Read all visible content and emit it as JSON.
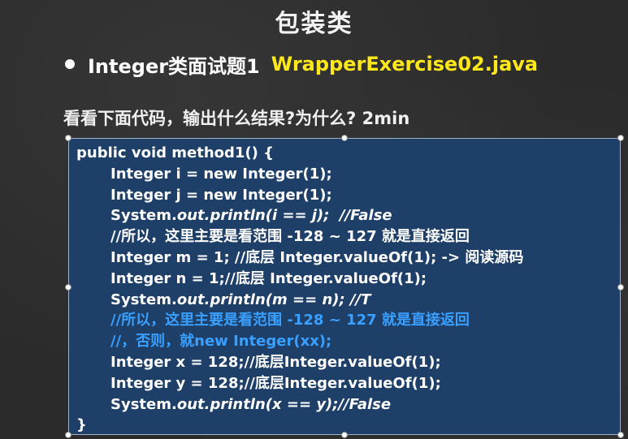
{
  "slide": {
    "title": "包装类",
    "bullet_text": "Integer类面试题1",
    "bullet_file": "WrapperExercise02.java",
    "question": "看看下面代码，输出什么结果?为什么? 2min"
  },
  "code": {
    "line1": "public void method1() {",
    "line2": "Integer i = new Integer(1);",
    "line3": "Integer j = new Integer(1);",
    "line4a": "System.",
    "line4b": "out.println(i == j);  //False",
    "line5": "//所以，这里主要是看范围 -128 ~ 127 就是直接返回",
    "line6": "Integer m = 1; //底层 Integer.valueOf(1); -> 阅读源码",
    "line7": "Integer n = 1;//底层 Integer.valueOf(1);",
    "line8a": "System.",
    "line8b": "out.println(m == n); //T",
    "line9": "//所以，这里主要是看范围 -128 ~ 127 就是直接返回",
    "line10": "//，否则，就new Integer(xx);",
    "line11": "Integer x = 128;//底层Integer.valueOf(1);",
    "line12": "Integer y = 128;//底层Integer.valueOf(1);",
    "line13a": "System.",
    "line13b": "out.println(x == y);//False",
    "line14": "}"
  },
  "colors": {
    "highlight_yellow": "#ffe81a",
    "code_bg": "#1e3f68",
    "comment_blue": "#3aa0ff"
  }
}
